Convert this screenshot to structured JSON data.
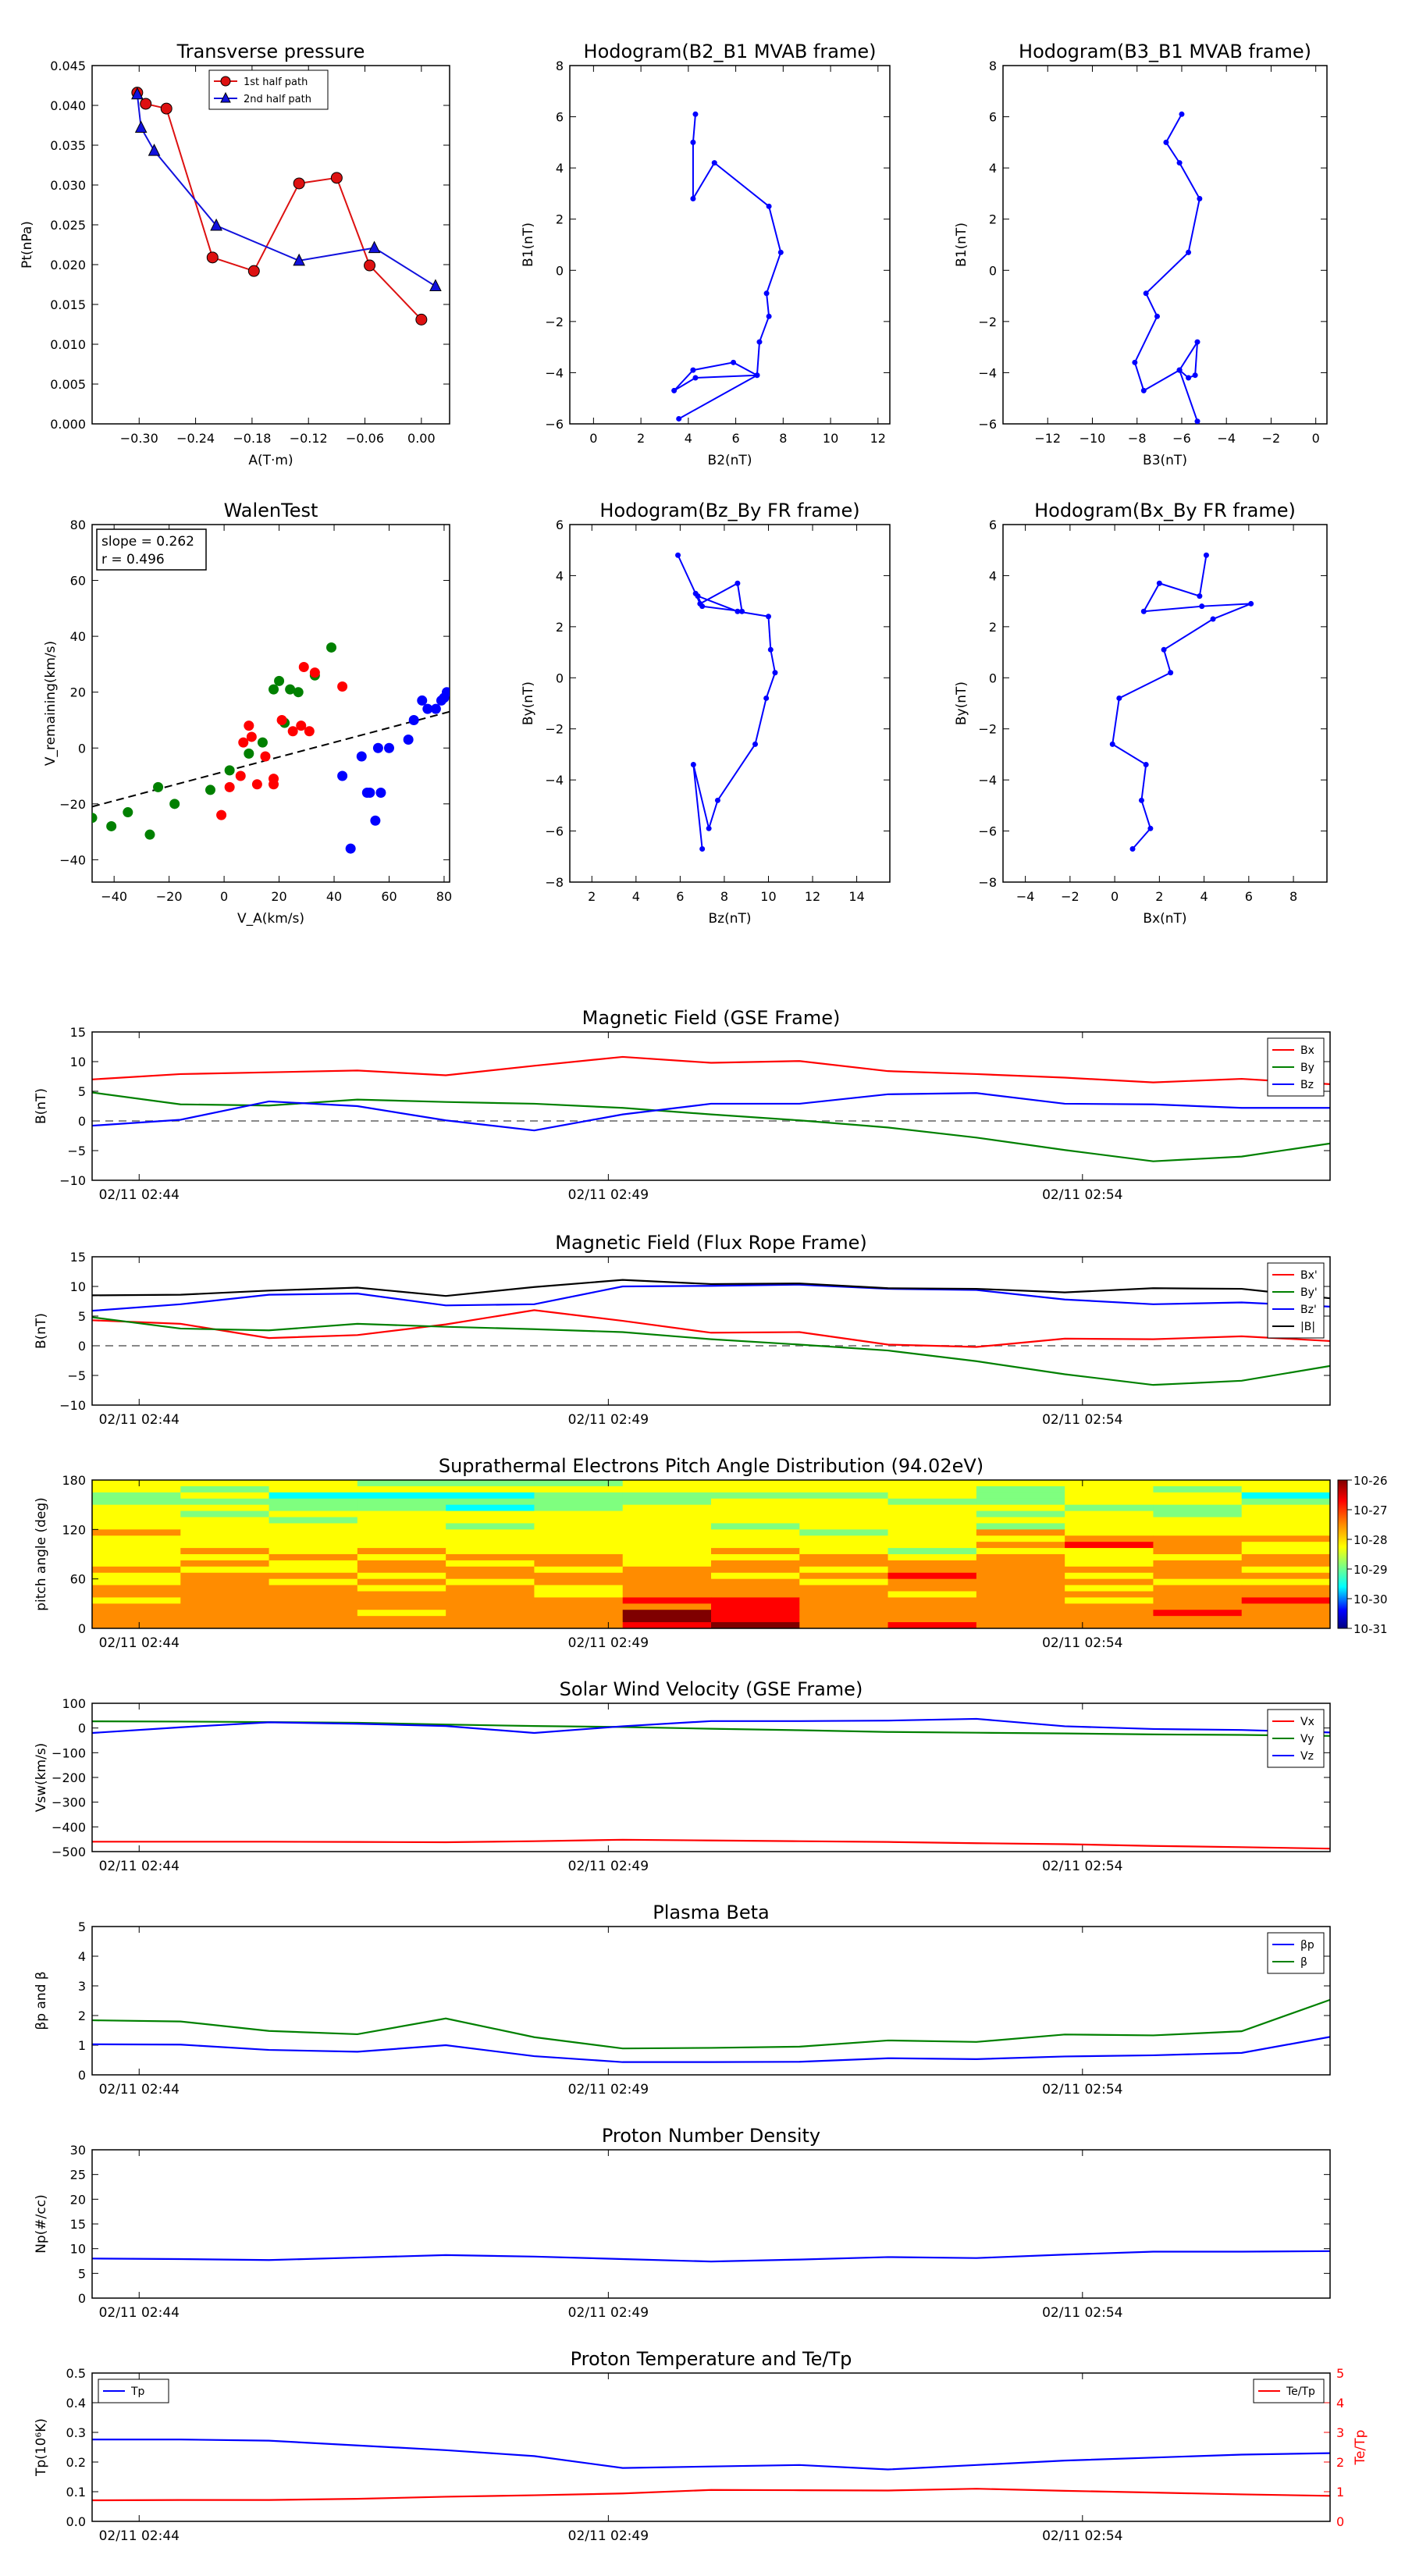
{
  "figure": {
    "time_ticks": [
      "02/11 02:44",
      "02/11 02:49",
      "02/11 02:54"
    ],
    "colorbar": {
      "labels": [
        "10-26",
        "10-27",
        "10-28",
        "10-29",
        "10-30",
        "10-31"
      ],
      "colors": [
        "#7f0000",
        "#ff0000",
        "#ff8c00",
        "#ffff00",
        "#7fff7f",
        "#00ffff",
        "#0000ff",
        "#00007f"
      ]
    }
  },
  "chart_data": [
    {
      "id": "transverse_pressure",
      "type": "scatter",
      "title": "Transverse pressure",
      "xlabel": "A(T·m)",
      "ylabel": "Pt(nPa)",
      "xlim": [
        -0.35,
        0.03
      ],
      "ylim": [
        0,
        0.045
      ],
      "xticks": [
        -0.3,
        -0.24,
        -0.18,
        -0.12,
        -0.06,
        0.0
      ],
      "xtick_labels": [
        "−0.30",
        "−0.24",
        "−0.18",
        "−0.12",
        "−0.06",
        "0.00"
      ],
      "yticks": [
        0,
        0.005,
        0.01,
        0.015,
        0.02,
        0.025,
        0.03,
        0.035,
        0.04,
        0.045
      ],
      "ytick_labels": [
        "0.000",
        "0.005",
        "0.010",
        "0.015",
        "0.020",
        "0.025",
        "0.030",
        "0.035",
        "0.040",
        "0.045"
      ],
      "legend": "top-center",
      "series": [
        {
          "name": "1st half path",
          "color": "#dd1111",
          "marker": "circle",
          "x": [
            -0.302,
            -0.293,
            -0.271,
            -0.222,
            -0.178,
            -0.13,
            -0.09,
            -0.055,
            0.0
          ],
          "y": [
            0.0416,
            0.0402,
            0.0396,
            0.0209,
            0.0192,
            0.0302,
            0.0309,
            0.0199,
            0.0131
          ]
        },
        {
          "name": "2nd half path",
          "color": "#1111dd",
          "marker": "triangle",
          "x": [
            -0.302,
            -0.298,
            -0.284,
            -0.218,
            -0.13,
            -0.05,
            0.015
          ],
          "y": [
            0.0414,
            0.0372,
            0.0343,
            0.0249,
            0.0205,
            0.0221,
            0.0173
          ]
        }
      ]
    },
    {
      "id": "hodo_b2b1",
      "type": "line",
      "title": "Hodogram(B2_B1 MVAB frame)",
      "xlabel": "B2(nT)",
      "ylabel": "B1(nT)",
      "xlim": [
        -1,
        12.5
      ],
      "ylim": [
        -6,
        8
      ],
      "xticks": [
        0,
        2,
        4,
        6,
        8,
        10,
        12
      ],
      "yticks": [
        -6,
        -4,
        -2,
        0,
        2,
        4,
        6,
        8
      ],
      "series": [
        {
          "color": "#0000ff",
          "x": [
            4.3,
            4.2,
            4.2,
            5.1,
            7.4,
            7.9,
            7.3,
            7.4,
            7.0,
            6.9,
            5.9,
            4.2,
            3.4,
            4.3,
            6.9,
            3.6
          ],
          "y": [
            6.1,
            5.0,
            2.8,
            4.2,
            2.5,
            0.7,
            -0.9,
            -1.8,
            -2.8,
            -4.1,
            -3.6,
            -3.9,
            -4.7,
            -4.2,
            -4.1,
            -5.8
          ]
        }
      ]
    },
    {
      "id": "hodo_b3b1",
      "type": "line",
      "title": "Hodogram(B3_B1 MVAB frame)",
      "xlabel": "B3(nT)",
      "ylabel": "B1(nT)",
      "xlim": [
        -14,
        0.5
      ],
      "ylim": [
        -6,
        8
      ],
      "xticks": [
        -12,
        -10,
        -8,
        -6,
        -4,
        -2,
        0
      ],
      "yticks": [
        -6,
        -4,
        -2,
        0,
        2,
        4,
        6,
        8
      ],
      "series": [
        {
          "color": "#0000ff",
          "x": [
            -6.0,
            -6.7,
            -6.1,
            -5.2,
            -5.7,
            -7.6,
            -7.1,
            -8.1,
            -7.7,
            -6.1,
            -5.3,
            -5.4,
            -5.7,
            -6.1,
            -5.3
          ],
          "y": [
            6.1,
            5.0,
            4.2,
            2.8,
            0.7,
            -0.9,
            -1.8,
            -3.6,
            -4.7,
            -3.9,
            -2.8,
            -4.1,
            -4.2,
            -3.9,
            -5.9
          ]
        }
      ]
    },
    {
      "id": "walen",
      "type": "scatter",
      "title": "WalenTest",
      "xlabel": "V_A(km/s)",
      "ylabel": "V_remaining(km/s)",
      "xlim": [
        -48,
        82
      ],
      "ylim": [
        -48,
        80
      ],
      "xticks": [
        -40,
        -20,
        0,
        20,
        40,
        60,
        80
      ],
      "yticks": [
        -40,
        -20,
        0,
        20,
        40,
        60,
        80
      ],
      "annotation": [
        "slope = 0.262",
        "r = 0.496"
      ],
      "fit": {
        "slope": 0.262,
        "x": [
          -48,
          82
        ],
        "y": [
          -21.0,
          13.0
        ]
      },
      "series": [
        {
          "color": "#008000",
          "x": [
            -48,
            -41,
            -35,
            -27,
            -24,
            -18,
            -5,
            2,
            9,
            14,
            18,
            20,
            22,
            24,
            27,
            33,
            39
          ],
          "y": [
            -25,
            -28,
            -23,
            -31,
            -14,
            -20,
            -15,
            -8,
            -2,
            2,
            21,
            24,
            9,
            21,
            20,
            26,
            36
          ]
        },
        {
          "color": "#ff0000",
          "x": [
            -1,
            2,
            6,
            7,
            9,
            10,
            12,
            15,
            18,
            18,
            21,
            25,
            28,
            29,
            31,
            33,
            43
          ],
          "y": [
            -24,
            -14,
            -10,
            2,
            8,
            4,
            -13,
            -3,
            -11,
            -13,
            10,
            6,
            8,
            29,
            6,
            27,
            22
          ]
        },
        {
          "color": "#0000ff",
          "x": [
            43,
            46,
            50,
            52,
            53,
            55,
            56,
            57,
            60,
            67,
            69,
            72,
            74,
            77,
            79,
            80,
            81
          ],
          "y": [
            -10,
            -36,
            -3,
            -16,
            -16,
            -26,
            0,
            -16,
            0,
            3,
            10,
            17,
            14,
            14,
            17,
            18,
            20
          ]
        }
      ]
    },
    {
      "id": "hodo_bzby",
      "type": "line",
      "title": "Hodogram(Bz_By FR frame)",
      "xlabel": "Bz(nT)",
      "ylabel": "By(nT)",
      "xlim": [
        1,
        15.5
      ],
      "ylim": [
        -8,
        6
      ],
      "xticks": [
        2,
        4,
        6,
        8,
        10,
        12,
        14
      ],
      "yticks": [
        -8,
        -6,
        -4,
        -2,
        0,
        2,
        4,
        6
      ],
      "series": [
        {
          "color": "#0000ff",
          "x": [
            5.9,
            6.7,
            6.9,
            8.6,
            8.8,
            7.0,
            6.8,
            8.6,
            10.0,
            10.1,
            10.3,
            9.9,
            9.4,
            7.7,
            7.3,
            6.6,
            7.0
          ],
          "y": [
            4.8,
            3.3,
            2.9,
            3.7,
            2.6,
            2.8,
            3.2,
            2.6,
            2.4,
            1.1,
            0.2,
            -0.8,
            -2.6,
            -4.8,
            -5.9,
            -3.4,
            -6.7
          ]
        }
      ]
    },
    {
      "id": "hodo_bxby",
      "type": "line",
      "title": "Hodogram(Bx_By FR frame)",
      "xlabel": "Bx(nT)",
      "ylabel": "By(nT)",
      "xlim": [
        -5,
        9.5
      ],
      "ylim": [
        -8,
        6
      ],
      "xticks": [
        -4,
        -2,
        0,
        2,
        4,
        6,
        8
      ],
      "yticks": [
        -8,
        -6,
        -4,
        -2,
        0,
        2,
        4,
        6
      ],
      "series": [
        {
          "color": "#0000ff",
          "x": [
            4.1,
            3.8,
            2.0,
            1.3,
            3.9,
            6.1,
            4.4,
            2.2,
            2.5,
            0.2,
            -0.1,
            1.4,
            1.2,
            1.6,
            0.8
          ],
          "y": [
            4.8,
            3.2,
            3.7,
            2.6,
            2.8,
            2.9,
            2.3,
            1.1,
            0.2,
            -0.8,
            -2.6,
            -3.4,
            -4.8,
            -5.9,
            -6.7
          ]
        }
      ]
    },
    {
      "id": "mag_gse",
      "type": "line",
      "title": "Magnetic Field (GSE Frame)",
      "ylabel": "B(nT)",
      "ylim": [
        -10,
        15
      ],
      "yticks": [
        -10,
        -5,
        0,
        5,
        10,
        15
      ],
      "zero_line": true,
      "legend": "top-right",
      "x": [
        0,
        1,
        2,
        3,
        4,
        5,
        6,
        7,
        8,
        9,
        10,
        11,
        12,
        13,
        14
      ],
      "series": [
        {
          "name": "Bx",
          "color": "#ff0000",
          "values": [
            7.0,
            7.9,
            8.2,
            8.5,
            7.7,
            9.3,
            10.8,
            9.8,
            10.1,
            8.4,
            7.9,
            7.3,
            6.5,
            7.1,
            6.2
          ]
        },
        {
          "name": "By",
          "color": "#008000",
          "values": [
            4.8,
            2.8,
            2.6,
            3.6,
            3.2,
            2.9,
            2.2,
            1.1,
            0.1,
            -1.1,
            -2.8,
            -4.9,
            -6.8,
            -6.0,
            -3.8
          ]
        },
        {
          "name": "Bz",
          "color": "#0000ff",
          "values": [
            -0.8,
            0.2,
            3.3,
            2.5,
            0.1,
            -1.6,
            1.1,
            2.9,
            2.9,
            4.5,
            4.7,
            2.9,
            2.8,
            2.2,
            2.2
          ]
        }
      ]
    },
    {
      "id": "mag_fr",
      "type": "line",
      "title": "Magnetic Field (Flux Rope Frame)",
      "ylabel": "B(nT)",
      "ylim": [
        -10,
        15
      ],
      "yticks": [
        -10,
        -5,
        0,
        5,
        10,
        15
      ],
      "zero_line": true,
      "legend": "top-right",
      "x": [
        0,
        1,
        2,
        3,
        4,
        5,
        6,
        7,
        8,
        9,
        10,
        11,
        12,
        13,
        14
      ],
      "series": [
        {
          "name": "Bx'",
          "color": "#ff0000",
          "values": [
            4.3,
            3.7,
            1.3,
            1.8,
            3.6,
            6.0,
            4.2,
            2.2,
            2.3,
            0.2,
            -0.2,
            1.2,
            1.1,
            1.6,
            0.8
          ]
        },
        {
          "name": "By'",
          "color": "#008000",
          "values": [
            4.8,
            2.9,
            2.6,
            3.7,
            3.2,
            2.8,
            2.3,
            1.1,
            0.2,
            -0.8,
            -2.6,
            -4.8,
            -6.6,
            -5.9,
            -3.4
          ]
        },
        {
          "name": "Bz'",
          "color": "#0000ff",
          "values": [
            5.9,
            7.0,
            8.6,
            8.8,
            6.8,
            7.0,
            10.0,
            10.1,
            10.3,
            9.6,
            9.4,
            7.8,
            7.0,
            7.3,
            6.6
          ]
        },
        {
          "name": "|B|",
          "color": "#000000",
          "values": [
            8.5,
            8.6,
            9.3,
            9.8,
            8.4,
            9.9,
            11.1,
            10.4,
            10.5,
            9.7,
            9.6,
            9.0,
            9.7,
            9.6,
            8.0
          ]
        }
      ]
    },
    {
      "id": "pad",
      "type": "heatmap",
      "title": "Suprathermal Electrons Pitch Angle Distribution (94.02eV)",
      "ylabel": "pitch angle (deg)",
      "ylim": [
        0,
        180
      ],
      "yticks": [
        0,
        60,
        120,
        180
      ],
      "columns": 14,
      "rows": 24,
      "values": [
        "44433344444444",
        "43444444443434",
        "34222333343442",
        "33333334433443",
        "44332344444334",
        "43444444443434",
        "44344444444444",
        "44443443443444",
        "54444444345444",
        "44444444444555",
        "44444444445654",
        "45454445434454",
        "44545544545445",
        "45454545555455",
        "54455455455554",
        "45545554565455",
        "45454555455544",
        "55545455555455",
        "55555455545555",
        "45555566555456",
        "55555556555555",
        "55545576555565",
        "55555576555555",
        "55555567565555"
      ]
    },
    {
      "id": "sw_velocity",
      "type": "line",
      "title": "Solar Wind Velocity (GSE Frame)",
      "ylabel": "Vsw(km/s)",
      "ylim": [
        -500,
        100
      ],
      "yticks": [
        -500,
        -400,
        -300,
        -200,
        -100,
        0,
        100
      ],
      "legend": "top-right",
      "x": [
        0,
        1,
        2,
        3,
        4,
        5,
        6,
        7,
        8,
        9,
        10,
        11,
        12,
        13,
        14
      ],
      "series": [
        {
          "name": "Vx",
          "color": "#ff0000",
          "values": [
            -460,
            -460,
            -460,
            -461,
            -462,
            -458,
            -452,
            -455,
            -458,
            -461,
            -466,
            -470,
            -477,
            -482,
            -488
          ]
        },
        {
          "name": "Vy",
          "color": "#008000",
          "values": [
            27,
            26,
            24,
            21,
            14,
            8,
            4,
            -3,
            -9,
            -16,
            -19,
            -22,
            -26,
            -28,
            -32
          ]
        },
        {
          "name": "Vz",
          "color": "#0000ff",
          "values": [
            -20,
            3,
            23,
            17,
            8,
            -20,
            7,
            28,
            28,
            30,
            37,
            7,
            -4,
            -8,
            -18
          ]
        }
      ]
    },
    {
      "id": "plasma_beta",
      "type": "line",
      "title": "Plasma Beta",
      "ylabel": "βp and β",
      "ylim": [
        0,
        5
      ],
      "yticks": [
        0,
        1,
        2,
        3,
        4,
        5
      ],
      "legend": "top-right",
      "x": [
        0,
        1,
        2,
        3,
        4,
        5,
        6,
        7,
        8,
        9,
        10,
        11,
        12,
        13,
        14
      ],
      "series": [
        {
          "name": "βp",
          "color": "#0000ff",
          "values": [
            1.03,
            1.02,
            0.84,
            0.78,
            1.0,
            0.63,
            0.43,
            0.43,
            0.44,
            0.56,
            0.53,
            0.62,
            0.66,
            0.74,
            1.28
          ]
        },
        {
          "name": "β",
          "color": "#008000",
          "values": [
            1.84,
            1.8,
            1.48,
            1.37,
            1.9,
            1.27,
            0.89,
            0.91,
            0.95,
            1.16,
            1.11,
            1.36,
            1.33,
            1.47,
            2.53
          ]
        }
      ]
    },
    {
      "id": "proton_density",
      "type": "line",
      "title": "Proton Number Density",
      "ylabel": "Np(#/cc)",
      "ylim": [
        0,
        30
      ],
      "yticks": [
        0,
        5,
        10,
        15,
        20,
        25,
        30
      ],
      "x": [
        0,
        1,
        2,
        3,
        4,
        5,
        6,
        7,
        8,
        9,
        10,
        11,
        12,
        13,
        14
      ],
      "series": [
        {
          "color": "#0000ff",
          "values": [
            8.0,
            7.9,
            7.7,
            8.2,
            8.7,
            8.4,
            7.9,
            7.4,
            7.8,
            8.3,
            8.1,
            8.8,
            9.4,
            9.4,
            9.5
          ]
        }
      ]
    },
    {
      "id": "proton_temp",
      "type": "line",
      "title": "Proton Temperature and Te/Tp",
      "ylabel": "Tp(10⁶K)",
      "ylabel_right": "Te/Tp",
      "ylim": [
        0,
        0.5
      ],
      "yticks": [
        0,
        0.1,
        0.2,
        0.3,
        0.4,
        0.5
      ],
      "ytick_labels": [
        "0.0",
        "0.1",
        "0.2",
        "0.3",
        "0.4",
        "0.5"
      ],
      "ylim_right": [
        0,
        5
      ],
      "yticks_right": [
        0,
        1,
        2,
        3,
        4,
        5
      ],
      "legend": [
        "top-left",
        "top-right"
      ],
      "x": [
        0,
        1,
        2,
        3,
        4,
        5,
        6,
        7,
        8,
        9,
        10,
        11,
        12,
        13,
        14
      ],
      "series": [
        {
          "name": "Tp",
          "color": "#0000ff",
          "axis": "left",
          "values": [
            0.276,
            0.276,
            0.272,
            0.256,
            0.24,
            0.22,
            0.18,
            0.185,
            0.19,
            0.175,
            0.19,
            0.205,
            0.215,
            0.225,
            0.23
          ]
        },
        {
          "name": "Te/Tp",
          "color": "#ff0000",
          "axis": "right",
          "values": [
            0.71,
            0.72,
            0.72,
            0.76,
            0.83,
            0.88,
            0.94,
            1.06,
            1.05,
            1.04,
            1.1,
            1.03,
            0.97,
            0.91,
            0.86
          ]
        }
      ]
    }
  ]
}
